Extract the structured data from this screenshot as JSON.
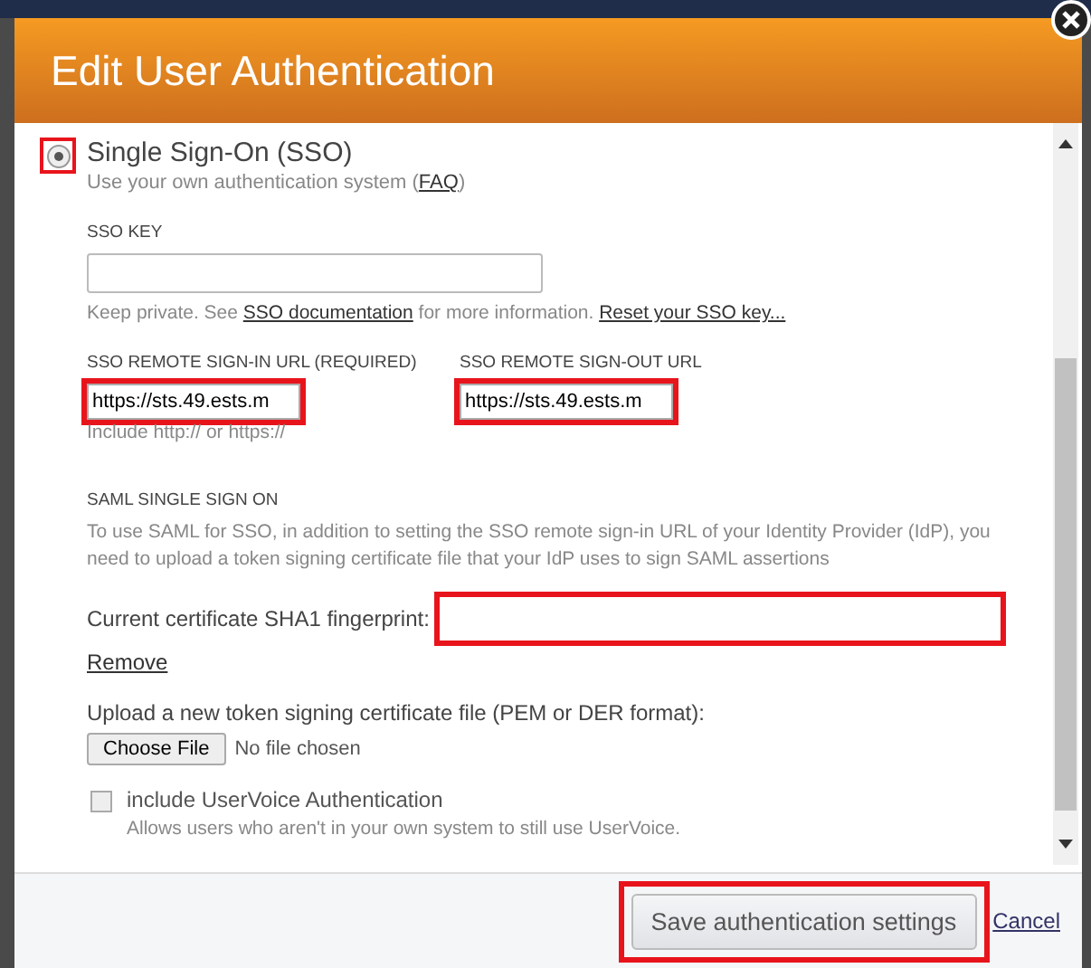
{
  "dialog": {
    "title": "Edit User Authentication"
  },
  "sso": {
    "label": "Single Sign-On (SSO)",
    "selected": true,
    "highlighted": true,
    "description_prefix": "Use your own authentication system (",
    "faq_link": "FAQ",
    "description_suffix": ")"
  },
  "sso_key": {
    "label": "SSO KEY",
    "hint_prefix": "Keep private. See",
    "doc_link": "SSO documentation",
    "hint_middle": "for more information.",
    "reset_link": "Reset your SSO key..."
  },
  "url_fields": [
    {
      "label": "SSO REMOTE SIGN-IN URL (REQUIRED)",
      "value": "https://sts.49.ests.m",
      "highlighted": true
    },
    {
      "label": "SSO REMOTE SIGN-OUT URL",
      "value": "https://sts.49.ests.m",
      "highlighted": true
    }
  ],
  "url_hint": "Include http:// or https://",
  "saml": {
    "heading": "SAML SINGLE SIGN ON",
    "description": "To use SAML for SSO, in addition to setting the SSO remote sign-in URL of your Identity Provider (IdP), you need to upload a token signing certificate file that your IdP uses to sign SAML assertions",
    "fingerprint_label": "Current certificate SHA1 fingerprint:",
    "fingerprint_highlighted": true,
    "remove_link": "Remove",
    "upload_label": "Upload a new token signing certificate file (PEM or DER format):",
    "choose_button": "Choose File",
    "file_status": "No file chosen"
  },
  "uservoice": {
    "label": "include UserVoice Authentication",
    "checked": false,
    "description": "Allows users who aren't in your own system to still use UserVoice."
  },
  "footer": {
    "save_button": "Save authentication settings",
    "save_highlighted": true,
    "cancel_link": "Cancel"
  }
}
